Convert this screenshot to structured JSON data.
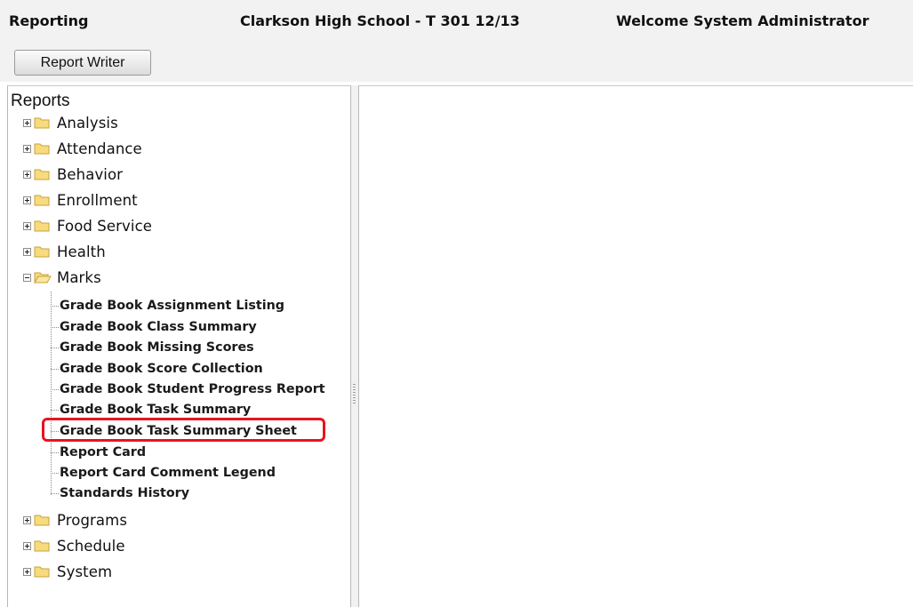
{
  "header": {
    "app_name": "Reporting",
    "school": "Clarkson High School - T 301 12/13",
    "welcome": "Welcome System Administrator"
  },
  "toolbar": {
    "report_writer_label": "Report Writer"
  },
  "tree": {
    "title": "Reports",
    "folders": [
      {
        "label": "Analysis",
        "state": "collapsed"
      },
      {
        "label": "Attendance",
        "state": "collapsed"
      },
      {
        "label": "Behavior",
        "state": "collapsed"
      },
      {
        "label": "Enrollment",
        "state": "collapsed"
      },
      {
        "label": "Food Service",
        "state": "collapsed"
      },
      {
        "label": "Health",
        "state": "collapsed"
      },
      {
        "label": "Marks",
        "state": "expanded"
      },
      {
        "label": "Programs",
        "state": "collapsed"
      },
      {
        "label": "Schedule",
        "state": "collapsed"
      },
      {
        "label": "System",
        "state": "collapsed"
      }
    ],
    "marks_items": [
      "Grade Book Assignment Listing",
      "Grade Book Class Summary",
      "Grade Book Missing Scores",
      "Grade Book Score Collection",
      "Grade Book Student Progress Report",
      "Grade Book Task Summary",
      "Grade Book Task Summary Sheet",
      "Report Card",
      "Report Card Comment Legend",
      "Standards History"
    ],
    "highlighted_item": "Grade Book Task Summary Sheet"
  },
  "icons": {
    "expand": "plus-box-icon",
    "collapse": "minus-box-icon",
    "folder_closed": "folder-icon",
    "folder_open": "folder-open-icon"
  },
  "colors": {
    "folder": "#f3d36e",
    "highlight": "#e8141e",
    "header_bg": "#f2f2f2"
  }
}
